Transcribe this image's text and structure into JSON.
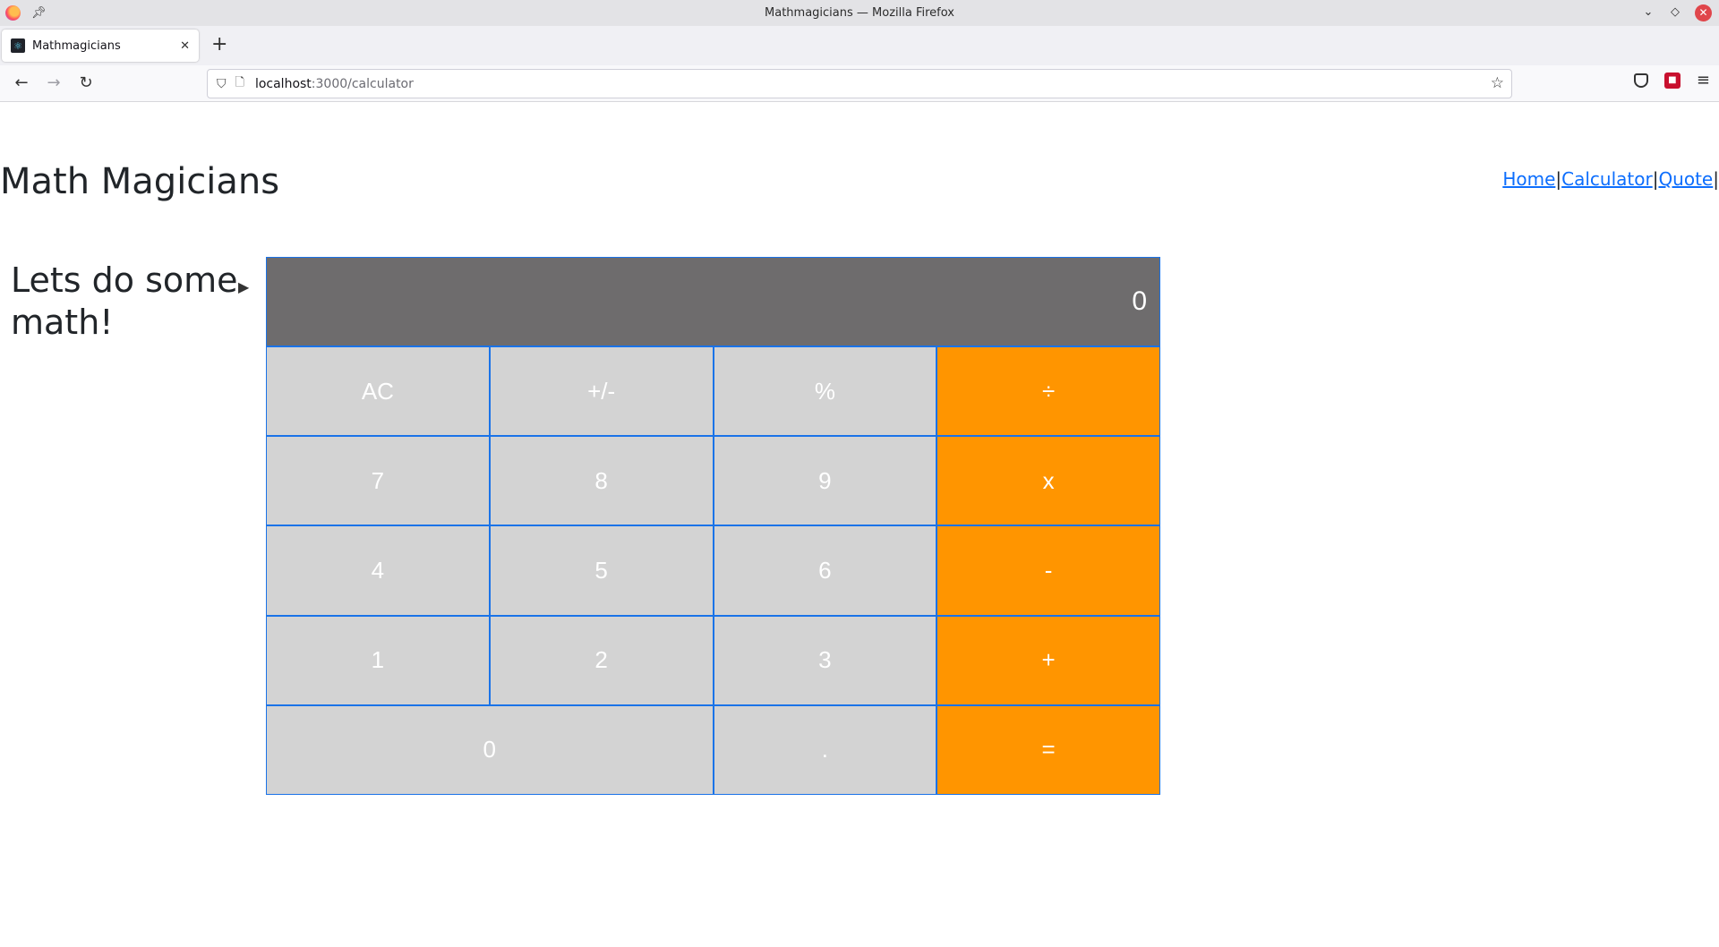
{
  "window": {
    "title": "Mathmagicians — Mozilla Firefox"
  },
  "browser": {
    "tab_label": "Mathmagicians",
    "url_host": "localhost",
    "url_path": ":3000/calculator"
  },
  "site": {
    "title": "Math Magicians",
    "nav": [
      {
        "label": "Home"
      },
      {
        "label": "Calculator"
      },
      {
        "label": "Quote"
      }
    ],
    "separator": "|"
  },
  "intro": "Lets do some math!",
  "calculator": {
    "display": "0",
    "keys": [
      {
        "label": "AC",
        "op": false
      },
      {
        "label": "+/-",
        "op": false
      },
      {
        "label": "%",
        "op": false
      },
      {
        "label": "÷",
        "op": true
      },
      {
        "label": "7",
        "op": false
      },
      {
        "label": "8",
        "op": false
      },
      {
        "label": "9",
        "op": false
      },
      {
        "label": "x",
        "op": true
      },
      {
        "label": "4",
        "op": false
      },
      {
        "label": "5",
        "op": false
      },
      {
        "label": "6",
        "op": false
      },
      {
        "label": "-",
        "op": true
      },
      {
        "label": "1",
        "op": false
      },
      {
        "label": "2",
        "op": false
      },
      {
        "label": "3",
        "op": false
      },
      {
        "label": "+",
        "op": true
      },
      {
        "label": "0",
        "op": false,
        "wide": true
      },
      {
        "label": ".",
        "op": false
      },
      {
        "label": "=",
        "op": true
      }
    ]
  },
  "colors": {
    "key_bg": "#d3d3d3",
    "operator_bg": "#ff9500",
    "display_bg": "#6e6c6d",
    "key_border": "#1a73e8",
    "link": "#0d6efd"
  }
}
